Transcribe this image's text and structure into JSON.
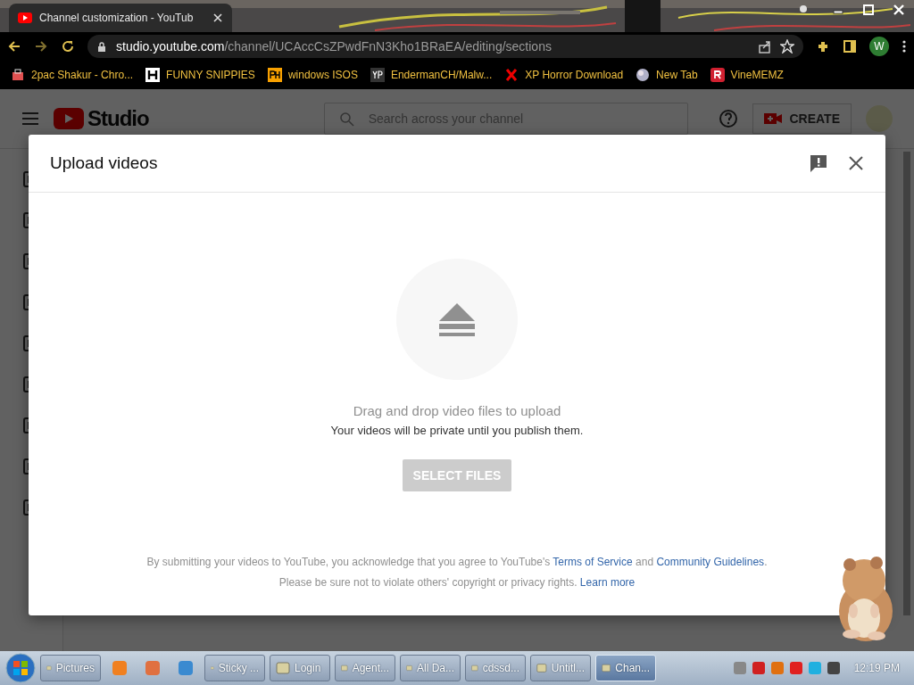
{
  "browser": {
    "tab": {
      "title": "Channel customization - YouTub"
    },
    "address": {
      "domain": "studio.youtube.com",
      "path": "/channel/UCAccCsZPwdFnN3Kho1BRaEA/editing/sections"
    },
    "profile": "W",
    "bookmarks": [
      {
        "label": "2pac Shakur - Chro..."
      },
      {
        "label": "FUNNY SNIPPIES"
      },
      {
        "label": "windows ISOS"
      },
      {
        "label": "EndermanCH/Malw..."
      },
      {
        "label": "XP Horror Download"
      },
      {
        "label": "New Tab"
      },
      {
        "label": "VineMEMZ"
      }
    ]
  },
  "studio": {
    "logo": "Studio",
    "search": {
      "placeholder": "Search across your channel"
    },
    "create": "CREATE"
  },
  "dialog": {
    "title": "Upload videos",
    "heading": "Drag and drop video files to upload",
    "subtext": "Your videos will be private until you publish them.",
    "button": {
      "label": "SELECT FILES",
      "disabled": true
    },
    "legal": [
      [
        {
          "kind": "text",
          "text": "By submitting your videos to YouTube, you acknowledge that you agree to YouTube's "
        },
        {
          "kind": "link",
          "text": "Terms of Service"
        },
        {
          "kind": "text",
          "text": " and "
        },
        {
          "kind": "link",
          "text": "Community Guidelines"
        },
        {
          "kind": "text",
          "text": "."
        }
      ],
      [
        {
          "kind": "text",
          "text": "Please be sure not to violate others' copyright or privacy rights. "
        },
        {
          "kind": "link",
          "text": "Learn more"
        }
      ]
    ]
  },
  "taskbar": {
    "items": [
      {
        "label": "Pictures",
        "selected": false
      },
      {
        "label": "Sticky ...",
        "selected": false
      },
      {
        "label": "Login",
        "selected": false
      },
      {
        "label": "Agent...",
        "selected": false
      },
      {
        "label": "All Da...",
        "selected": false
      },
      {
        "label": "cdssd...",
        "selected": false
      },
      {
        "label": "Untitl...",
        "selected": false
      },
      {
        "label": "Chan...",
        "selected": true
      }
    ],
    "clock": "12:19 PM"
  }
}
